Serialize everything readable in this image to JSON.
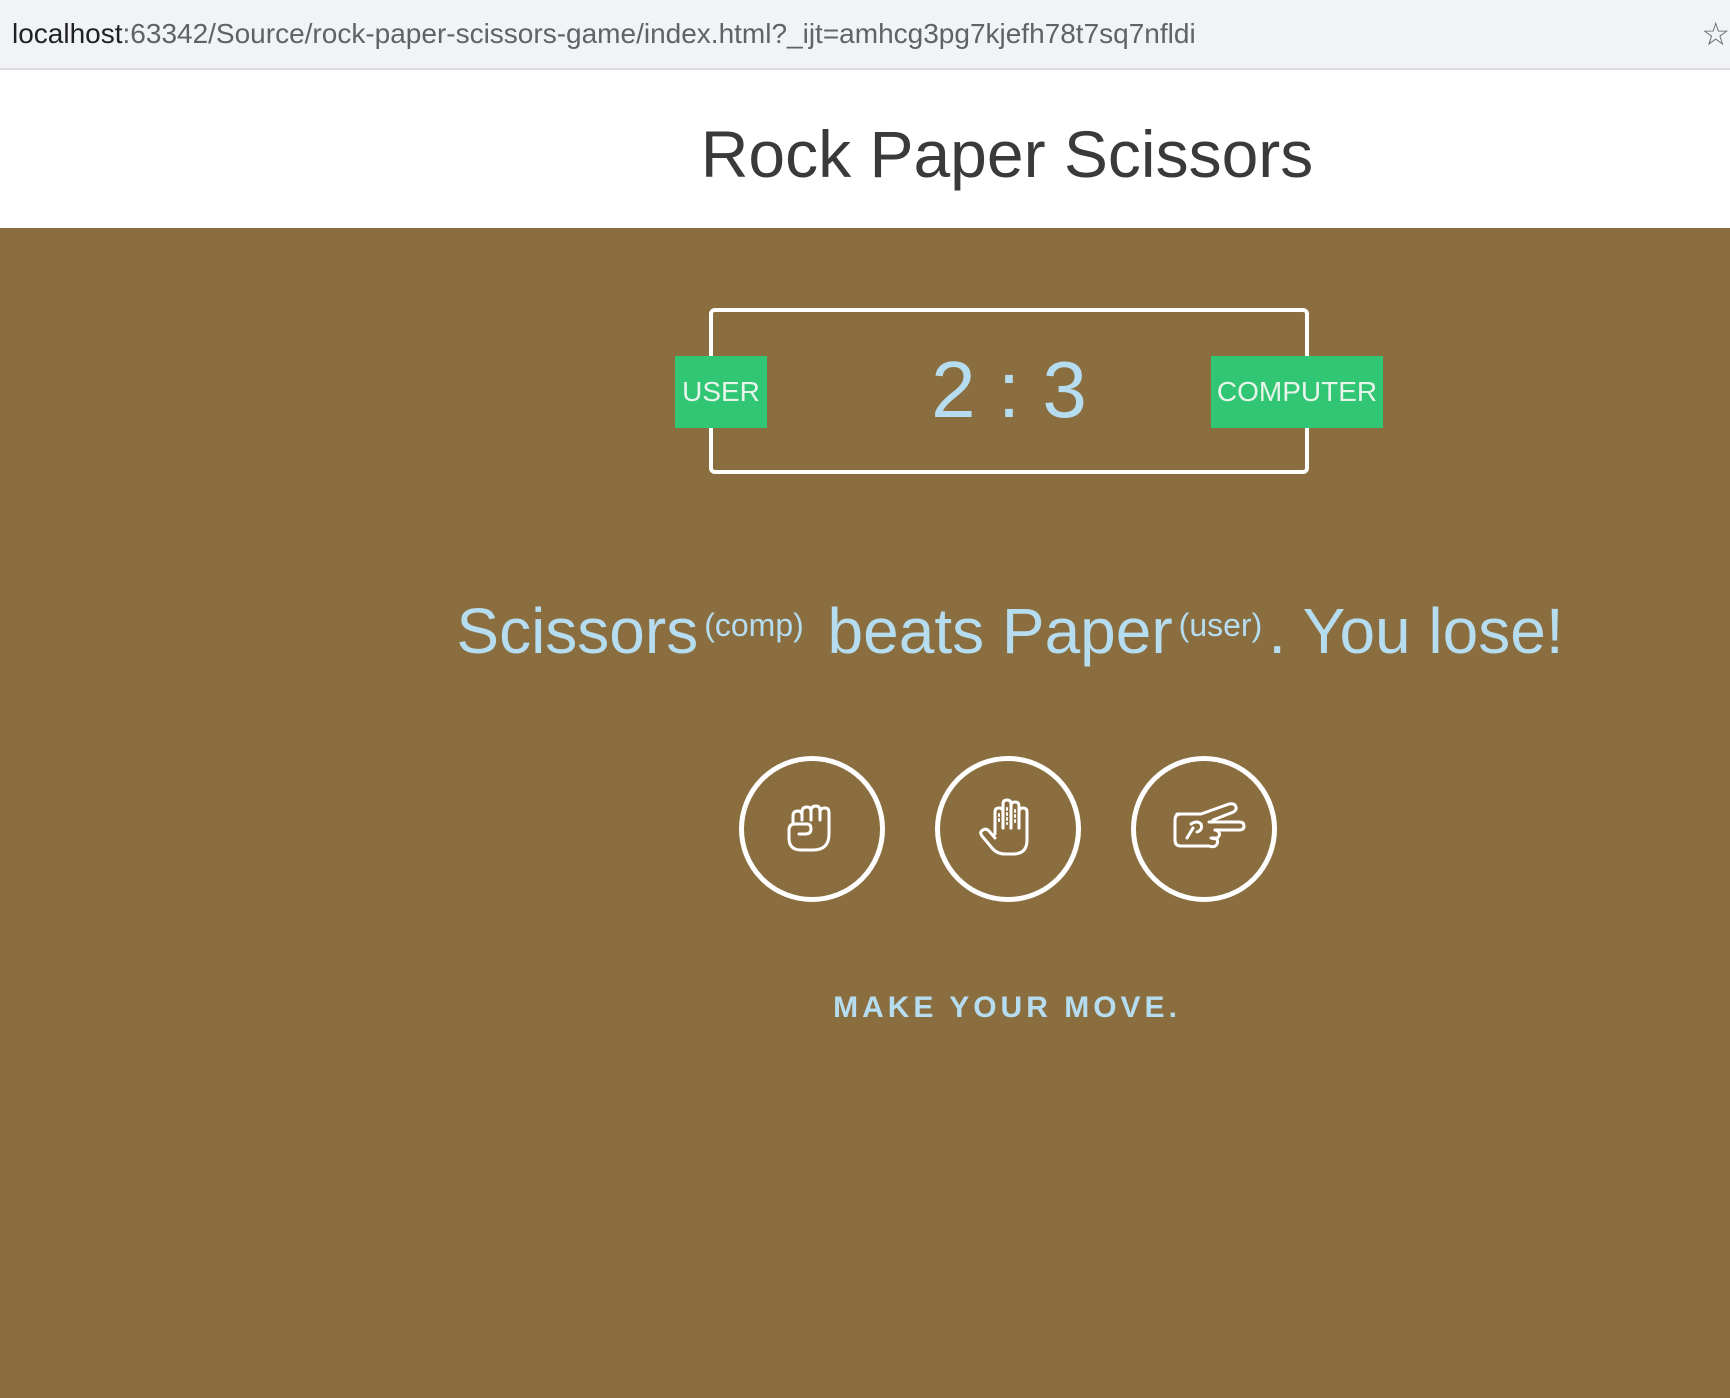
{
  "browser": {
    "url_host": "localhost",
    "url_rest": ":63342/Source/rock-paper-scissors-game/index.html?_ijt=amhcg3pg7kjefh78t7sq7nfldi",
    "star_glyph": "☆"
  },
  "header": {
    "title": "Rock Paper Scissors"
  },
  "scoreboard": {
    "user_label": "USER",
    "computer_label": "COMPUTER",
    "user_score": "2",
    "separator": ":",
    "computer_score": "3"
  },
  "result": {
    "winner_move": "Scissors",
    "winner_tag": "(comp)",
    "verb": "beats",
    "loser_move": "Paper",
    "loser_tag": "(user)",
    "outcome": ". You lose!"
  },
  "choices": [
    {
      "name": "rock",
      "icon": "rock-fist-icon"
    },
    {
      "name": "paper",
      "icon": "paper-hand-icon"
    },
    {
      "name": "scissors",
      "icon": "scissors-hand-icon"
    }
  ],
  "prompt": "MAKE YOUR MOVE.",
  "colors": {
    "board_bg": "#8a6e40",
    "badge_bg": "#31c673",
    "text_accent": "#b5dcef"
  }
}
